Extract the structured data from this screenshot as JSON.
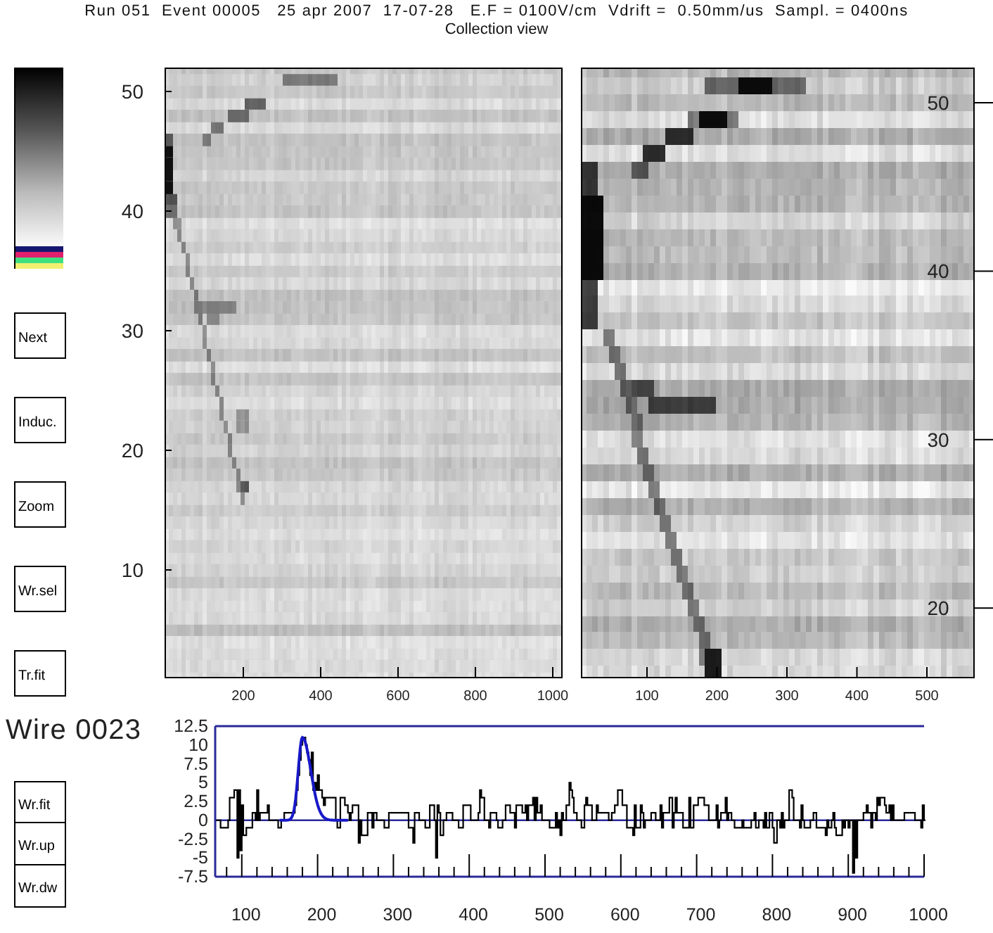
{
  "header": {
    "run_info": "Run 051  Event 00005   25 apr 2007  17-07-28   E.F = 0100V/cm  Vdrift =  0.50mm/us  Sampl. = 0400ns",
    "view": "Collection view"
  },
  "buttons": [
    "Next",
    "Induc.",
    "Zoom",
    "Wr.sel",
    "Tr.fit"
  ],
  "full_view": {
    "y_ticks": [
      "50",
      "40",
      "30",
      "20",
      "10"
    ],
    "x_ticks": [
      "200",
      "400",
      "600",
      "800",
      "1000"
    ]
  },
  "zoom_view": {
    "y_ticks": [
      "50",
      "40",
      "30",
      "20"
    ],
    "x_ticks": [
      "100",
      "200",
      "300",
      "400",
      "500"
    ]
  },
  "wire_panel": {
    "title": "Wire 0023",
    "buttons": [
      "Wr.fit",
      "Wr.up",
      "Wr.dw"
    ],
    "y_ticks": [
      "12.5",
      "10",
      "7.5",
      "5",
      "2.5",
      "0",
      "-2.5",
      "-5",
      "-7.5"
    ],
    "x_ticks": [
      "100",
      "200",
      "300",
      "400",
      "500",
      "600",
      "700",
      "800",
      "900",
      "1000"
    ]
  }
}
